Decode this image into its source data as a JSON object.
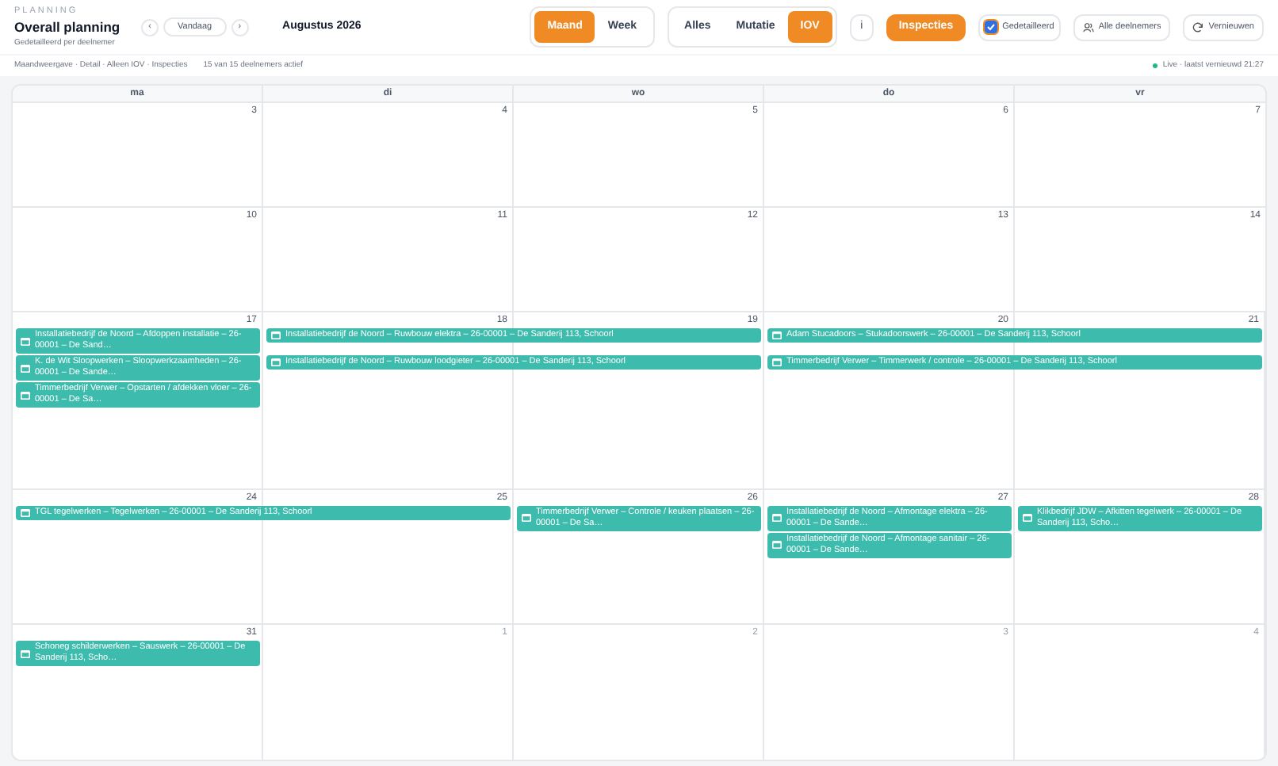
{
  "header": {
    "eyebrow": "PLANNING",
    "title": "Overall planning",
    "subtitle": "Gedetailleerd per deelnemer",
    "prev": "‹",
    "today": "Vandaag",
    "next": "›",
    "month": "Augustus 2026",
    "view_tabs": [
      {
        "label": "Maand",
        "selected": true
      },
      {
        "label": "Week",
        "selected": false
      }
    ],
    "filter_tabs": [
      {
        "label": "Alles",
        "selected": false
      },
      {
        "label": "Mutatie",
        "selected": false
      },
      {
        "label": "IOV",
        "selected": true
      }
    ],
    "info": "i",
    "inspections": {
      "label": "Inspecties",
      "on": true
    },
    "detailed": {
      "label": "Gedetailleerd",
      "checked": true
    },
    "participants": "Alle deelnemers",
    "refresh": "Vernieuwen"
  },
  "filter_bar": {
    "summary": "Maandweergave · Detail · Alleen IOV · Inspecties",
    "count": "15 van 15 deelnemers actief",
    "live": "Live · laatst vernieuwd 21:27"
  },
  "calendar": {
    "weekdays": [
      "ma",
      "di",
      "wo",
      "do",
      "vr"
    ],
    "weeks": [
      {
        "days": [
          {
            "label": "3",
            "outside": false
          },
          {
            "label": "4",
            "outside": false
          },
          {
            "label": "5",
            "outside": false
          },
          {
            "label": "6",
            "outside": false
          },
          {
            "label": "7",
            "outside": false
          }
        ]
      },
      {
        "days": [
          {
            "label": "10",
            "outside": false
          },
          {
            "label": "11",
            "outside": false
          },
          {
            "label": "12",
            "outside": false
          },
          {
            "label": "13",
            "outside": false
          },
          {
            "label": "14",
            "outside": false
          }
        ]
      },
      {
        "days": [
          {
            "label": "17",
            "outside": false
          },
          {
            "label": "18",
            "outside": false
          },
          {
            "label": "19",
            "outside": false
          },
          {
            "label": "20",
            "outside": false
          },
          {
            "label": "21",
            "outside": false
          }
        ],
        "lanes": [
          [
            {
              "kind": "start",
              "text": "Installatiebedrijf de Noord – Afdoppen installatie – 26-00001 – De Sand…"
            },
            {
              "kind": "start",
              "text": "Installatiebedrijf de Noord – Ruwbouw elektra – 26-00001 – De Sanderij 113, Schoorl"
            },
            {
              "kind": "continued"
            },
            {
              "kind": "start",
              "text": "Adam Stucadoors – Stukadoorswerk – 26-00001 – De Sanderij 113, Schoorl"
            },
            {
              "kind": "continued"
            }
          ],
          [
            {
              "kind": "start",
              "text": "K. de Wit Sloopwerken – Sloopwerkzaamheden – 26-00001 – De Sande…"
            },
            {
              "kind": "start",
              "text": "Installatiebedrijf de Noord – Ruwbouw loodgieter – 26-00001 – De Sanderij 113, Schoorl"
            },
            {
              "kind": "continued"
            },
            {
              "kind": "start",
              "text": "Timmerbedrijf Verwer – Timmerwerk / controle – 26-00001 – De Sanderij 113, Schoorl"
            },
            {
              "kind": "continued"
            }
          ],
          [
            {
              "kind": "start",
              "text": "Timmerbedrijf Verwer – Opstarten / afdekken vloer – 26-00001 – De Sa…"
            },
            {
              "kind": "empty"
            },
            {
              "kind": "empty"
            },
            {
              "kind": "empty"
            },
            {
              "kind": "empty"
            }
          ]
        ]
      },
      {
        "days": [
          {
            "label": "24",
            "outside": false
          },
          {
            "label": "25",
            "outside": false
          },
          {
            "label": "26",
            "outside": false
          },
          {
            "label": "27",
            "outside": false
          },
          {
            "label": "28",
            "outside": false
          }
        ],
        "lanes": [
          [
            {
              "kind": "start",
              "text": "TGL tegelwerken – Tegelwerken – 26-00001 – De Sanderij 113, Schoorl"
            },
            {
              "kind": "continued"
            },
            {
              "kind": "start",
              "text": "Timmerbedrijf Verwer – Controle / keuken plaatsen – 26-00001 – De Sa…"
            },
            {
              "kind": "start",
              "text": "Installatiebedrijf de Noord – Afmontage elektra – 26-00001 – De Sande…"
            },
            {
              "kind": "start",
              "text": "Klikbedrijf JDW – Afkitten tegelwerk – 26-00001 – De Sanderij 113, Scho…"
            }
          ],
          [
            {
              "kind": "empty"
            },
            {
              "kind": "empty"
            },
            {
              "kind": "empty"
            },
            {
              "kind": "start",
              "text": "Installatiebedrijf de Noord – Afmontage sanitair – 26-00001 – De Sande…"
            },
            {
              "kind": "empty"
            }
          ]
        ]
      },
      {
        "days": [
          {
            "label": "31",
            "outside": false
          },
          {
            "label": "1",
            "outside": true
          },
          {
            "label": "2",
            "outside": true
          },
          {
            "label": "3",
            "outside": true
          },
          {
            "label": "4",
            "outside": true
          }
        ],
        "lanes": [
          [
            {
              "kind": "start",
              "text": "Schoneg schilderwerken – Sauswerk – 26-00001 – De Sanderij 113, Scho…"
            },
            {
              "kind": "empty"
            },
            {
              "kind": "empty"
            },
            {
              "kind": "empty"
            },
            {
              "kind": "empty"
            }
          ]
        ]
      }
    ]
  }
}
